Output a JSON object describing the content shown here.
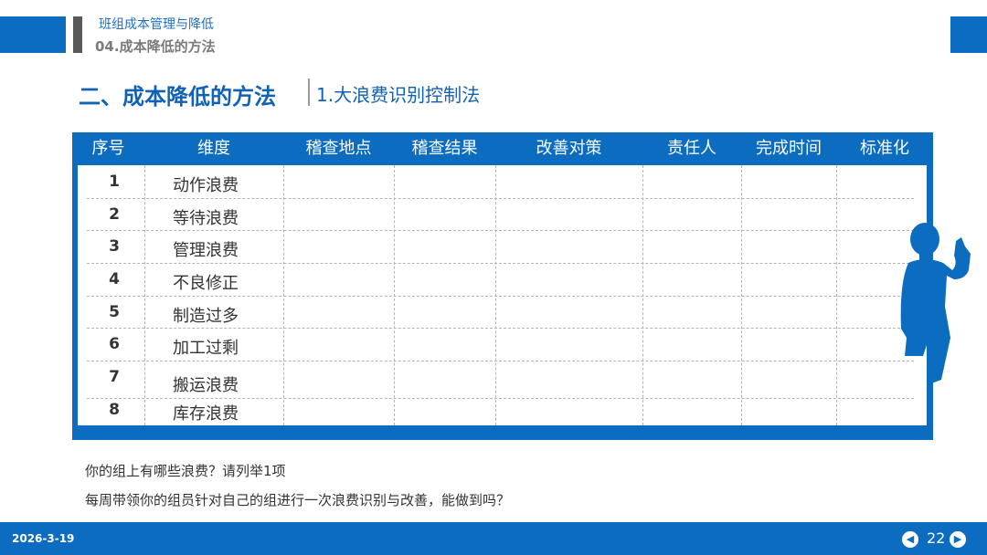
{
  "header": {
    "line1": "班组成本管理与降低",
    "line2": "04.成本降低的方法"
  },
  "section": {
    "title": "二、成本降低的方法",
    "subtitle": "1.大浪费识别控制法"
  },
  "table": {
    "columns": [
      "序号",
      "维度",
      "稽查地点",
      "稽查结果",
      "改善对策",
      "责任人",
      "完成时间",
      "标准化"
    ],
    "rows": [
      {
        "num": "1",
        "dim": "动作浪费"
      },
      {
        "num": "2",
        "dim": "等待浪费"
      },
      {
        "num": "3",
        "dim": "管理浪费"
      },
      {
        "num": "4",
        "dim": "不良修正"
      },
      {
        "num": "5",
        "dim": "制造过多"
      },
      {
        "num": "6",
        "dim": "加工过剩"
      },
      {
        "num": "7",
        "dim": "搬运浪费"
      },
      {
        "num": "8",
        "dim": "库存浪费"
      }
    ]
  },
  "notes": {
    "q1": "你的组上有哪些浪费？请列举1项",
    "q2": "每周带领你的组员针对自己的组进行一次浪费识别与改善，能做到吗？"
  },
  "footer": {
    "date": "2026-3-19",
    "page": "22",
    "prev_icon": "arrow-left-icon",
    "next_icon": "arrow-right-icon"
  },
  "colors": {
    "brand_blue": "#0b6cc0",
    "title_blue": "#1162b4",
    "dark_gray": "#595959"
  }
}
